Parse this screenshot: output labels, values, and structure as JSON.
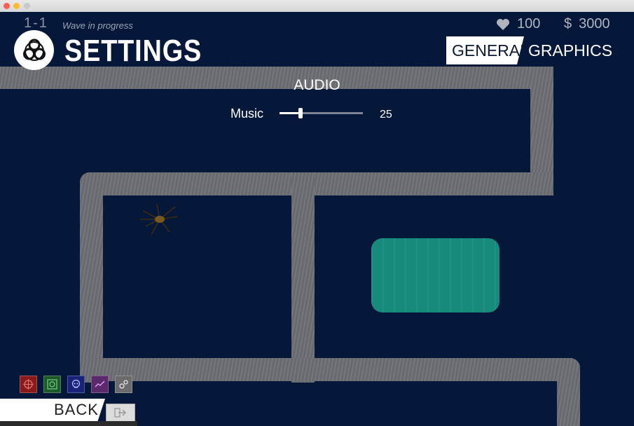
{
  "hud": {
    "level": "1-1",
    "wave_status": "Wave in progress",
    "lives": "100",
    "money_symbol": "$",
    "money": "3000"
  },
  "header": {
    "title": "SETTINGS"
  },
  "tabs": [
    {
      "label": "GENERAL",
      "active": true
    },
    {
      "label": "GRAPHICS",
      "active": false
    }
  ],
  "settings": {
    "section_title": "AUDIO",
    "music": {
      "label": "Music",
      "value": "25",
      "fraction": 0.25
    }
  },
  "tools": [
    {
      "icon": "crosshair-icon",
      "color": "#8a1a1a"
    },
    {
      "icon": "radar-icon",
      "color": "#1d5a2a"
    },
    {
      "icon": "skull-icon",
      "color": "#1a237a"
    },
    {
      "icon": "trend-icon",
      "color": "#5a2a6a"
    },
    {
      "icon": "gears-icon",
      "color": "#6b6b6b"
    }
  ],
  "footer": {
    "back_label": "BACK"
  },
  "colors": {
    "background": "#06183a",
    "path": "#6d6f74",
    "pool": "#168a7b",
    "accent": "#ffffff"
  }
}
